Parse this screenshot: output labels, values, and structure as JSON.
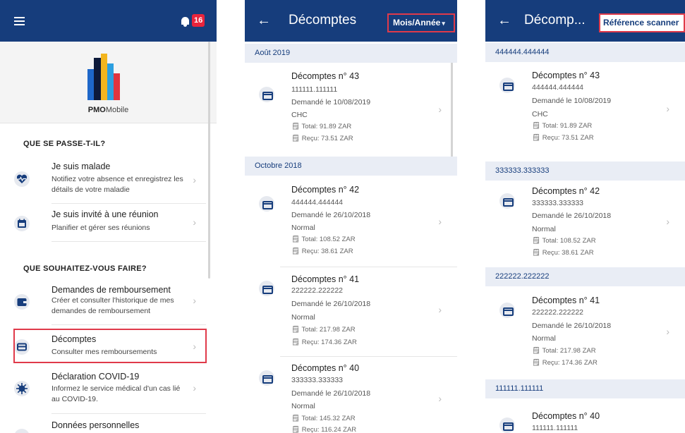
{
  "panel1": {
    "badge_count": "16",
    "logo": {
      "brand_bold": "PMO",
      "brand_rest": "Mobile"
    },
    "section1_title": "QUE SE PASSE-T-IL?",
    "section2_title": "QUE SOUHAITEZ-VOUS FAIRE?",
    "items": [
      {
        "title": "Je suis malade",
        "subtitle": "Notifiez votre absence et enregistrez les détails de votre maladie",
        "icon": "heartbeat-icon"
      },
      {
        "title": "Je suis invité à une réunion",
        "subtitle": "Planifier et gérer ses réunions",
        "icon": "calendar-icon"
      },
      {
        "title": "Demandes de remboursement",
        "subtitle": "Créer et consulter l'historique de mes demandes de remboursement",
        "icon": "wallet-icon"
      },
      {
        "title": "Décomptes",
        "subtitle": "Consulter mes remboursements",
        "icon": "card-icon"
      },
      {
        "title": "Déclaration COVID-19",
        "subtitle": "Informez le service médical d'un cas lié au COVID-19.",
        "icon": "virus-icon"
      },
      {
        "title": "Données personnelles",
        "subtitle": "",
        "icon": "person-icon"
      }
    ]
  },
  "panel2": {
    "back": "←",
    "title": "Décomptes",
    "filter_label": "Mois/Année",
    "caret": "▾",
    "groups": [
      {
        "label": "Août 2019"
      },
      {
        "label": "Octobre 2018"
      }
    ],
    "entries": [
      {
        "title": "Décomptes n° 43",
        "ref": "111111.111111",
        "date": "Demandé le 10/08/2019",
        "type": "CHC",
        "total": "Total: 91.89 ZAR",
        "recu": "Reçu: 73.51 ZAR"
      },
      {
        "title": "Décomptes n° 42",
        "ref": "444444.444444",
        "date": "Demandé le 26/10/2018",
        "type": "Normal",
        "total": "Total: 108.52 ZAR",
        "recu": "Reçu: 38.61 ZAR"
      },
      {
        "title": "Décomptes n° 41",
        "ref": "222222.222222",
        "date": "Demandé le 26/10/2018",
        "type": "Normal",
        "total": "Total: 217.98 ZAR",
        "recu": "Reçu: 174.36 ZAR"
      },
      {
        "title": "Décomptes n° 40",
        "ref": "333333.333333",
        "date": "Demandé le 26/10/2018",
        "type": "Normal",
        "total": "Total: 145.32 ZAR",
        "recu": "Reçu: 116.24 ZAR"
      }
    ]
  },
  "panel3": {
    "back": "←",
    "title": "Décomp...",
    "filter_label": "Référence scanner",
    "groups": [
      {
        "label": "444444.444444"
      },
      {
        "label": "333333.333333"
      },
      {
        "label": "222222.222222"
      },
      {
        "label": "111111.111111"
      }
    ],
    "entries": [
      {
        "title": "Décomptes n° 43",
        "ref": "444444.444444",
        "date": "Demandé le 10/08/2019",
        "type": "CHC",
        "total": "Total: 91.89 ZAR",
        "recu": "Reçu: 73.51 ZAR"
      },
      {
        "title": "Décomptes n° 42",
        "ref": "333333.333333",
        "date": "Demandé le 26/10/2018",
        "type": "Normal",
        "total": "Total: 108.52 ZAR",
        "recu": "Reçu: 38.61 ZAR"
      },
      {
        "title": "Décomptes n° 41",
        "ref": "222222.222222",
        "date": "Demandé le 26/10/2018",
        "type": "Normal",
        "total": "Total: 217.98 ZAR",
        "recu": "Reçu: 174.36 ZAR"
      },
      {
        "title": "Décomptes n° 40",
        "ref": "111111.111111"
      }
    ]
  },
  "colors": {
    "primary": "#163d7c",
    "highlight": "#e03a4a",
    "badge": "#e8243c",
    "group_bg": "#e9edf5"
  }
}
